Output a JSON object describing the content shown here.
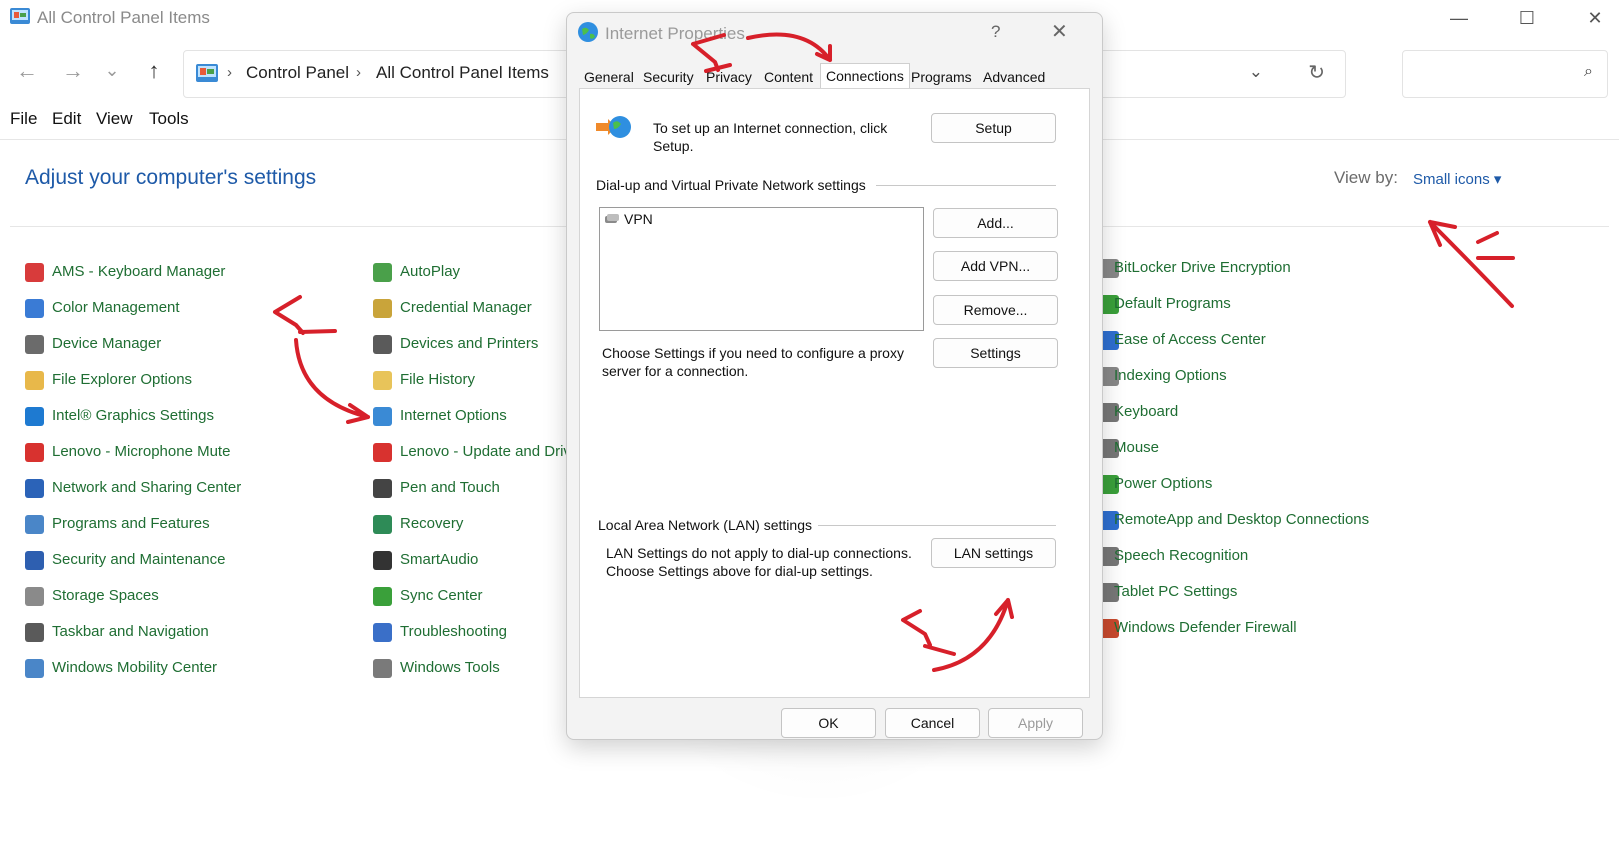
{
  "window": {
    "title": "All Control Panel Items",
    "caption": {
      "minimize": "—",
      "maximize": "☐",
      "close": "✕"
    }
  },
  "nav": {
    "back": "←",
    "forward": "→",
    "recent": "⌄",
    "up": "↑"
  },
  "address": {
    "crumbs": [
      "Control Panel",
      "All Control Panel Items"
    ],
    "separator": "›",
    "dropdown": "⌄",
    "refresh": "↻"
  },
  "search": {
    "icon": "⌕"
  },
  "menu": [
    "File",
    "Edit",
    "View",
    "Tools"
  ],
  "page": {
    "title": "Adjust your computer's settings",
    "view_by_label": "View by:",
    "view_by_value": "Small icons ▾"
  },
  "items": {
    "col1": [
      {
        "label": "AMS - Keyboard Manager",
        "icon": "keyboard-icon",
        "color": "#d83b3b"
      },
      {
        "label": "Color Management",
        "icon": "color-management-icon",
        "color": "#3a7bd5"
      },
      {
        "label": "Device Manager",
        "icon": "device-manager-icon",
        "color": "#6b6b6b"
      },
      {
        "label": "File Explorer Options",
        "icon": "folder-icon",
        "color": "#e8b84a"
      },
      {
        "label": "Intel® Graphics Settings",
        "icon": "intel-graphics-icon",
        "color": "#1e7ad1"
      },
      {
        "label": "Lenovo - Microphone Mute",
        "icon": "microphone-mute-icon",
        "color": "#d8322f"
      },
      {
        "label": "Network and Sharing Center",
        "icon": "network-icon",
        "color": "#2b63b8"
      },
      {
        "label": "Programs and Features",
        "icon": "programs-icon",
        "color": "#4a86c8"
      },
      {
        "label": "Security and Maintenance",
        "icon": "flag-icon",
        "color": "#2e5fb0"
      },
      {
        "label": "Storage Spaces",
        "icon": "storage-icon",
        "color": "#8a8a8a"
      },
      {
        "label": "Taskbar and Navigation",
        "icon": "taskbar-icon",
        "color": "#5a5a5a"
      },
      {
        "label": "Windows Mobility Center",
        "icon": "mobility-icon",
        "color": "#4a86c8"
      }
    ],
    "col2": [
      {
        "label": "AutoPlay",
        "icon": "autoplay-icon",
        "color": "#4aa04a"
      },
      {
        "label": "Credential Manager",
        "icon": "credential-icon",
        "color": "#c9a43a"
      },
      {
        "label": "Devices and Printers",
        "icon": "printer-icon",
        "color": "#5a5a5a"
      },
      {
        "label": "File History",
        "icon": "file-history-icon",
        "color": "#e8c45a"
      },
      {
        "label": "Internet Options",
        "icon": "internet-options-icon",
        "color": "#3a8ad5"
      },
      {
        "label": "Lenovo - Update and Drivers",
        "icon": "lenovo-update-icon",
        "color": "#d8322f"
      },
      {
        "label": "Pen and Touch",
        "icon": "pen-icon",
        "color": "#444444"
      },
      {
        "label": "Recovery",
        "icon": "recovery-icon",
        "color": "#2e8b57"
      },
      {
        "label": "SmartAudio",
        "icon": "headphones-icon",
        "color": "#333333"
      },
      {
        "label": "Sync Center",
        "icon": "sync-icon",
        "color": "#3aa03a"
      },
      {
        "label": "Troubleshooting",
        "icon": "troubleshooting-icon",
        "color": "#3a6fc8"
      },
      {
        "label": "Windows Tools",
        "icon": "tools-icon",
        "color": "#7a7a7a"
      }
    ],
    "col3": [
      {
        "label": "BitLocker Drive Encryption",
        "icon": "bitlocker-icon",
        "color": "#888888"
      },
      {
        "label": "Default Programs",
        "icon": "default-programs-icon",
        "color": "#3aa03a"
      },
      {
        "label": "Ease of Access Center",
        "icon": "ease-of-access-icon",
        "color": "#2e6fd0"
      },
      {
        "label": "Indexing Options",
        "icon": "indexing-icon",
        "color": "#888888"
      },
      {
        "label": "Keyboard",
        "icon": "keyboard-icon",
        "color": "#777777"
      },
      {
        "label": "Mouse",
        "icon": "mouse-icon",
        "color": "#777777"
      },
      {
        "label": "Power Options",
        "icon": "power-icon",
        "color": "#3aa03a"
      },
      {
        "label": "RemoteApp and Desktop Connections",
        "icon": "remote-icon",
        "color": "#2e6fd0"
      },
      {
        "label": "Speech Recognition",
        "icon": "microphone-icon",
        "color": "#777777"
      },
      {
        "label": "Tablet PC Settings",
        "icon": "tablet-icon",
        "color": "#777777"
      },
      {
        "label": "Windows Defender Firewall",
        "icon": "firewall-icon",
        "color": "#c84a2e"
      }
    ]
  },
  "dialog": {
    "title": "Internet Properties",
    "help": "?",
    "close": "✕",
    "tabs": [
      "General",
      "Security",
      "Privacy",
      "Content",
      "Connections",
      "Programs",
      "Advanced"
    ],
    "active_tab": "Connections",
    "setup_text": "To set up an Internet connection, click Setup.",
    "setup_button": "Setup",
    "dialup_group": "Dial-up and Virtual Private Network settings",
    "vpn_entry": "VPN",
    "add_button": "Add...",
    "add_vpn_button": "Add VPN...",
    "remove_button": "Remove...",
    "proxy_text": "Choose Settings if you need to configure a proxy server for a connection.",
    "settings_button": "Settings",
    "lan_group": "Local Area Network (LAN) settings",
    "lan_text": "LAN Settings do not apply to dial-up connections. Choose Settings above for dial-up settings.",
    "lan_button": "LAN settings",
    "ok_button": "OK",
    "cancel_button": "Cancel",
    "apply_button": "Apply"
  },
  "annotations": {
    "color": "#d7202a",
    "step_marks": [
      "Y",
      "Y",
      "Y",
      "Y"
    ]
  }
}
